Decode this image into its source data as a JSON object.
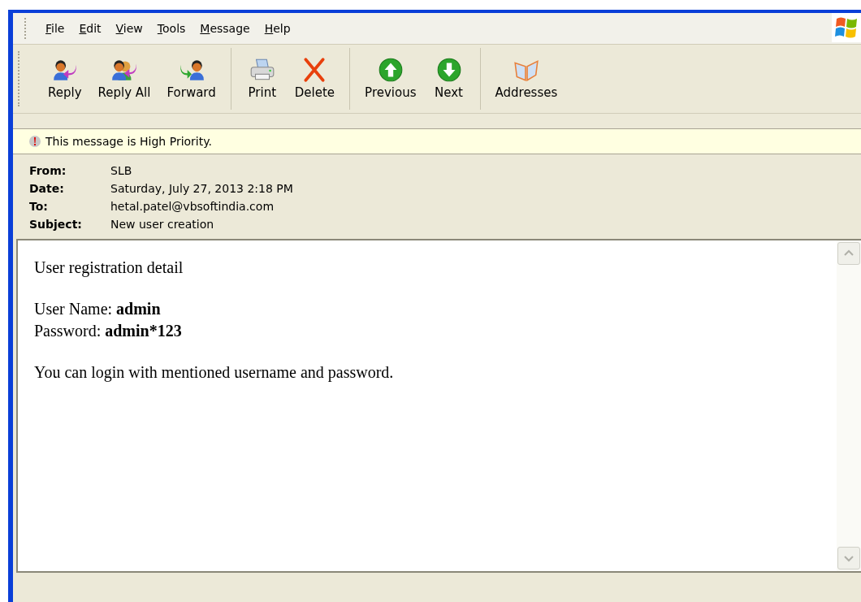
{
  "menu": [
    "File",
    "Edit",
    "View",
    "Tools",
    "Message",
    "Help"
  ],
  "toolbar": {
    "groups": [
      {
        "buttons": [
          {
            "label": "Reply",
            "kind": "reply"
          },
          {
            "label": "Reply All",
            "kind": "reply-all"
          },
          {
            "label": "Forward",
            "kind": "forward"
          }
        ]
      },
      {
        "buttons": [
          {
            "label": "Print",
            "kind": "print"
          },
          {
            "label": "Delete",
            "kind": "delete"
          }
        ]
      },
      {
        "buttons": [
          {
            "label": "Previous",
            "kind": "previous"
          },
          {
            "label": "Next",
            "kind": "next"
          }
        ]
      },
      {
        "buttons": [
          {
            "label": "Addresses",
            "kind": "addresses"
          }
        ]
      }
    ]
  },
  "priority_bar": {
    "text": "This message is High Priority."
  },
  "header": [
    {
      "label": "From:",
      "value": "SLB"
    },
    {
      "label": "Date:",
      "value": "Saturday, July 27, 2013 2:18 PM"
    },
    {
      "label": "To:",
      "value": "hetal.patel@vbsoftindia.com"
    },
    {
      "label": "Subject:",
      "value": "New user creation"
    }
  ],
  "body": {
    "paragraphs": [
      [
        "User registration detail"
      ],
      [
        "User Name: **admin**",
        "Password: **admin*123**"
      ],
      [
        "You can login with mentioned username and password."
      ]
    ]
  }
}
